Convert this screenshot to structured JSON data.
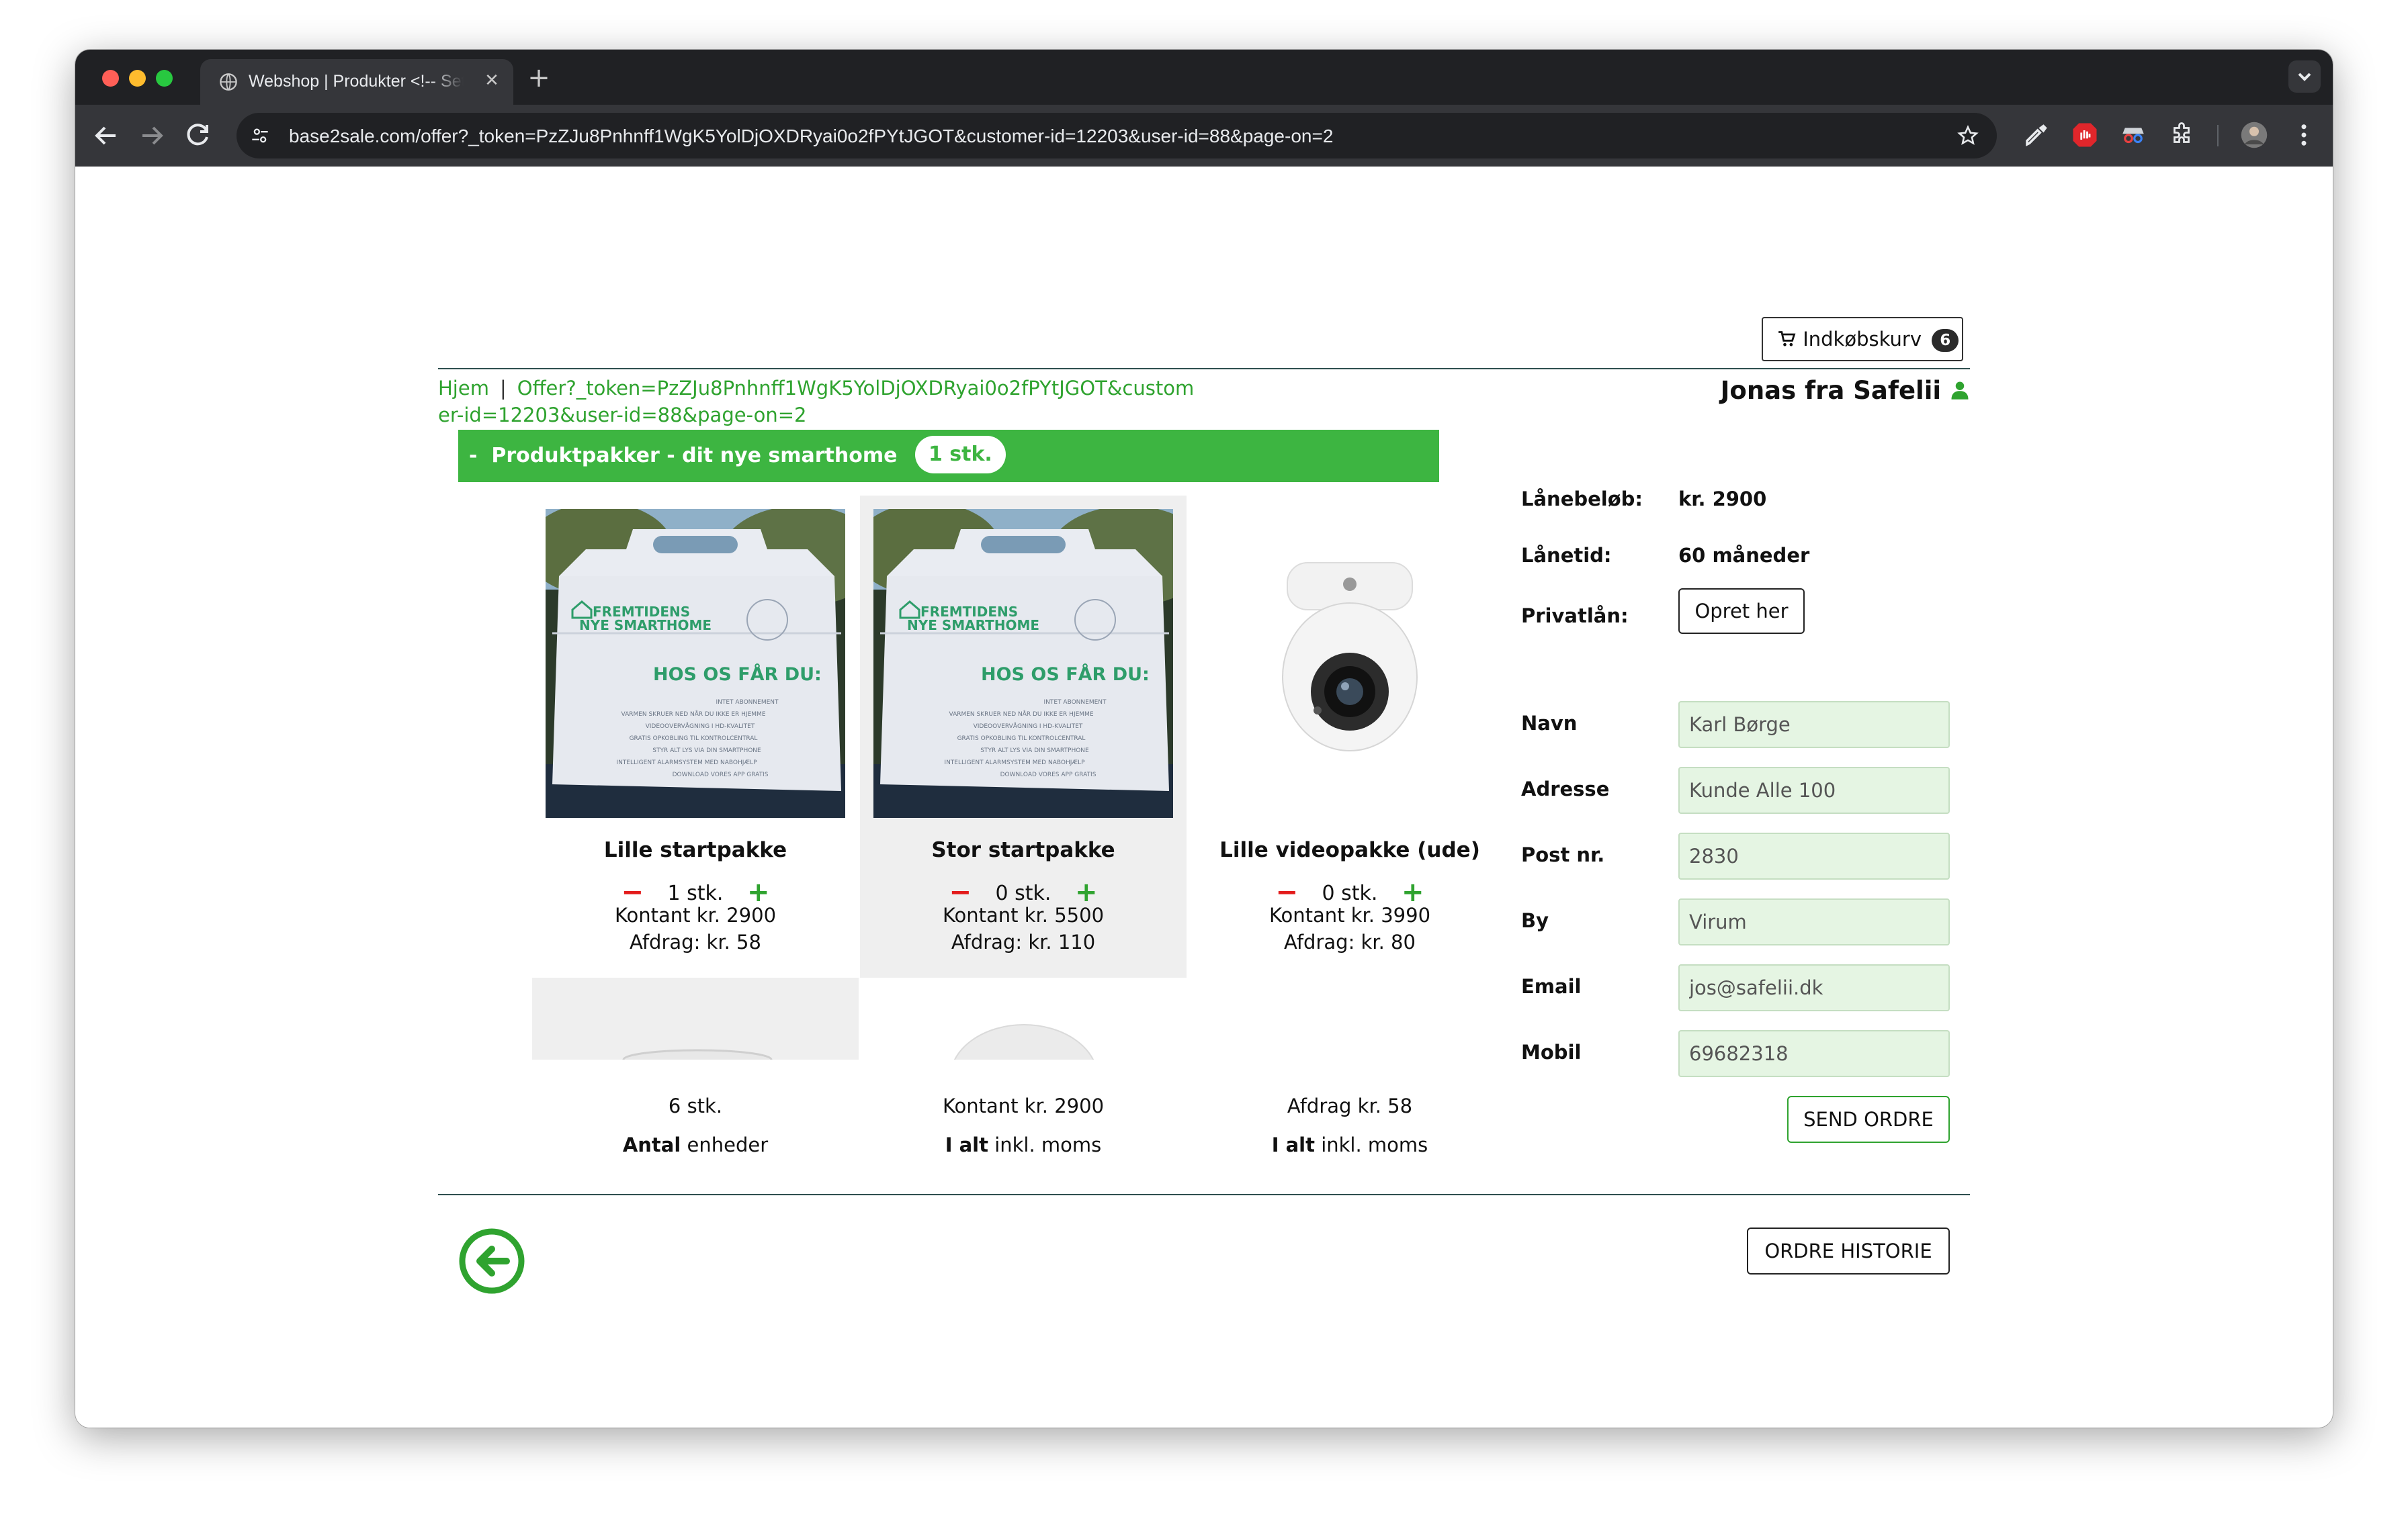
{
  "browser": {
    "tab_title": "Webshop | Produkter <!-- Set",
    "url": "base2sale.com/offer?_token=PzZJu8Pnhnff1WgK5YolDjOXDRyai0o2fPYtJGOT&customer-id=12203&user-id=88&page-on=2",
    "tab_close": "✕",
    "new_tab": "+"
  },
  "header": {
    "cart_label": "Indkøbskurv",
    "cart_count": "6",
    "user_name": "Jonas fra Safelii"
  },
  "breadcrumb": {
    "home": "Hjem",
    "separator": "|",
    "current": "Offer?_token=PzZJu8Pnhnff1WgK5YolDjOXDRyai0o2fPYtJGOT&customer-id=12203&user-id=88&page-on=2"
  },
  "section": {
    "prefix": "-",
    "title": "Produktpakker - dit nye smarthome",
    "count": "1 stk."
  },
  "products": [
    {
      "name": "Lille startpakke",
      "qty": "1 stk.",
      "price": "Kontant kr. 2900",
      "installment": "Afdrag: kr. 58"
    },
    {
      "name": "Stor startpakke",
      "qty": "0 stk.",
      "price": "Kontant kr. 5500",
      "installment": "Afdrag: kr. 110"
    },
    {
      "name": "Lille videopakke (ude)",
      "qty": "0 stk.",
      "price": "Kontant kr. 3990",
      "installment": "Afdrag: kr. 80"
    }
  ],
  "box_print": {
    "brand_line1": "FREMTIDENS",
    "brand_line2": "NYE SMARTHOME",
    "headline": "HOS OS FÅR DU:",
    "lines": [
      "INTET ABONNEMENT",
      "VARMEN SKRUER NED NÅR DU IKKE ER HJEMME",
      "VIDEOOVERVÅGNING I HD-KVALITET",
      "GRATIS OPKOBLING TIL KONTROLCENTRAL",
      "STYR ALT LYS VIA DIN SMARTPHONE",
      "INTELLIGENT ALARMSYSTEM MED NABOHJÆLP",
      "DOWNLOAD VORES APP GRATIS"
    ]
  },
  "summary": {
    "units_value": "6 stk.",
    "units_label_bold": "Antal",
    "units_label_rest": " enheder",
    "cash_value": "Kontant kr. 2900",
    "cash_label_bold": "I alt",
    "cash_label_rest": " inkl. moms",
    "inst_value": "Afdrag kr. 58",
    "inst_label_bold": "I alt",
    "inst_label_rest": " inkl. moms"
  },
  "loan": {
    "amount_label": "Lånebeløb:",
    "amount_value": "kr. 2900",
    "term_label": "Lånetid:",
    "term_value": "60 måneder",
    "private_label": "Privatlån:",
    "private_button": "Opret her"
  },
  "form": {
    "name_label": "Navn",
    "name_value": "Karl Børge",
    "address_label": "Adresse",
    "address_value": "Kunde Alle 100",
    "zip_label": "Post nr.",
    "zip_value": "2830",
    "city_label": "By",
    "city_value": "Virum",
    "email_label": "Email",
    "email_value": "jos@safelii.dk",
    "mobile_label": "Mobil",
    "mobile_value": "69682318",
    "send_button": "SEND ORDRE"
  },
  "footer": {
    "history_button": "ORDRE HISTORIE"
  },
  "colors": {
    "brand_green": "#3db541",
    "link_green": "#2fa32f",
    "minus_red": "#e31b1b",
    "field_bg": "#e5f5e3"
  },
  "icons": [
    "globe-icon",
    "back-icon",
    "forward-icon",
    "reload-icon",
    "site-settings-icon",
    "star-icon",
    "eyedropper-icon",
    "adblock-icon",
    "spy-icon",
    "puzzle-icon",
    "profile-avatar",
    "kebab-menu-icon",
    "cart-icon",
    "user-icon",
    "back-arrow-icon"
  ]
}
